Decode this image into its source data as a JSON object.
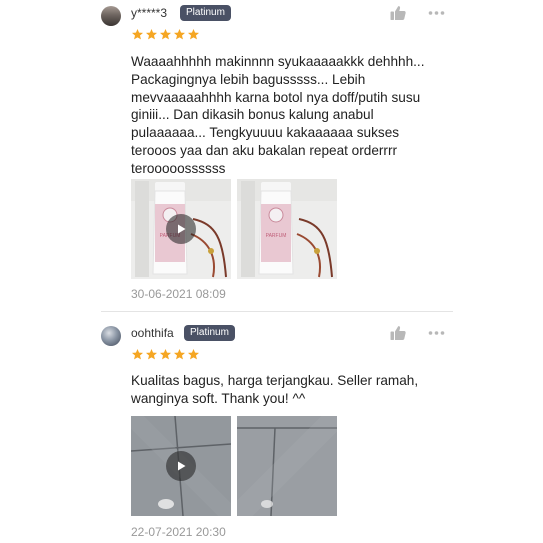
{
  "reviews": [
    {
      "username": "y*****3",
      "badge": "Platinum",
      "rating": 5,
      "text": "Waaaahhhhh makinnnn syukaaaaakkk dehhhh...\nPackagingnya lebih bagusssss... Lebih\nmevvaaaaahhhh karna botol nya doff/putih susu\nginiii... Dan dikasih bonus kalung anabul\npulaaaaaa... Tengkyuuuu kakaaaaaa sukses\nterooos yaa dan aku bakalan repeat orderrrr\nterooooossssss",
      "timestamp": "30-06-2021 08:09",
      "media": [
        {
          "kind": "video",
          "label": "PARFUM"
        },
        {
          "kind": "photo",
          "label": "PARFUM"
        }
      ]
    },
    {
      "username": "oohthifa",
      "badge": "Platinum",
      "rating": 5,
      "text": "Kualitas bagus, harga terjangkau. Seller ramah,\nwanginya soft. Thank you! ^^",
      "timestamp": "22-07-2021 20:30",
      "media": [
        {
          "kind": "video"
        },
        {
          "kind": "photo"
        }
      ]
    }
  ],
  "icons": {
    "like": "thumbs-up-icon",
    "more": "more-options-icon",
    "star": "star-icon",
    "play": "play-icon"
  },
  "colors": {
    "star": "#f5a623",
    "badge_bg": "#4a5165",
    "icon_gray": "#b8b8b8",
    "timestamp": "#999999"
  }
}
